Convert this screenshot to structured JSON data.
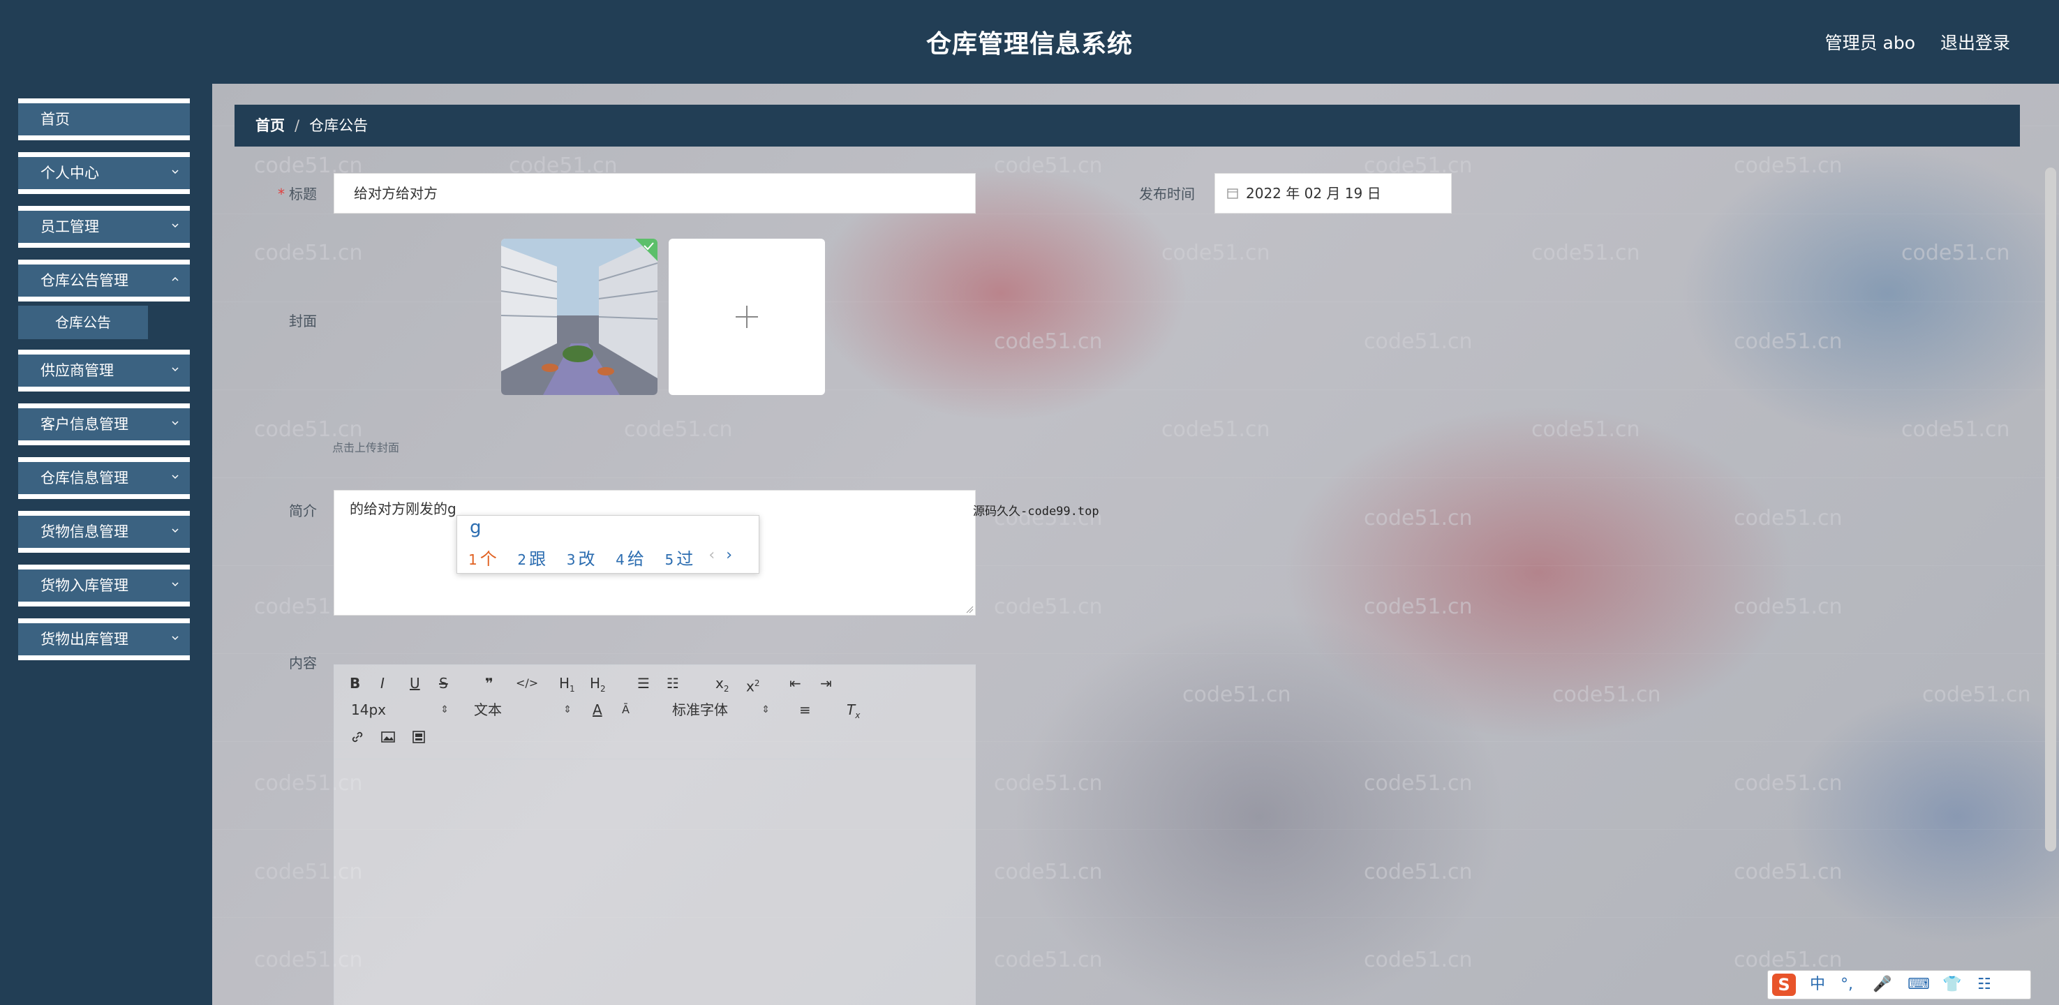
{
  "header": {
    "title": "仓库管理信息系统",
    "user": "管理员 abo",
    "logout": "退出登录"
  },
  "sidebar": {
    "items": [
      {
        "label": "首页",
        "expandable": false
      },
      {
        "label": "个人中心",
        "expandable": true
      },
      {
        "label": "员工管理",
        "expandable": true
      },
      {
        "label": "仓库公告管理",
        "expandable": true
      },
      {
        "label": "供应商管理",
        "expandable": true
      },
      {
        "label": "客户信息管理",
        "expandable": true
      },
      {
        "label": "仓库信息管理",
        "expandable": true
      },
      {
        "label": "货物信息管理",
        "expandable": true
      },
      {
        "label": "货物入库管理",
        "expandable": true
      },
      {
        "label": "货物出库管理",
        "expandable": true
      }
    ],
    "sub_item": "仓库公告"
  },
  "breadcrumb": {
    "home": "首页",
    "separator": "/",
    "current": "仓库公告"
  },
  "form": {
    "title_label": "标题",
    "title_value": "给对方给对方",
    "date_label": "发布时间",
    "date_value": "2022 年 02 月 19 日",
    "cover_label": "封面",
    "cover_tip": "点击上传封面",
    "intro_label": "简介",
    "intro_value": "的给对方刚发的g",
    "content_label": "内容"
  },
  "ime": {
    "typed": "g",
    "candidates": [
      {
        "n": "1",
        "text": "个"
      },
      {
        "n": "2",
        "text": "跟"
      },
      {
        "n": "3",
        "text": "改"
      },
      {
        "n": "4",
        "text": "给"
      },
      {
        "n": "5",
        "text": "过"
      }
    ],
    "prev": "‹",
    "next": "›"
  },
  "editor": {
    "font_size": "14px",
    "text_type": "文本",
    "font_family": "标准字体"
  },
  "overlay_text": "源码久久-code99.top",
  "watermark": "code51.cn",
  "tray": {
    "logo": "S",
    "items": [
      "中",
      "°,",
      "🎤",
      "⌨",
      "👕",
      "☷"
    ]
  },
  "colors": {
    "header_bg": "#223e55",
    "nav_item_bg": "#3b6281",
    "accent": "#2b6cb0",
    "required": "#e04040"
  }
}
